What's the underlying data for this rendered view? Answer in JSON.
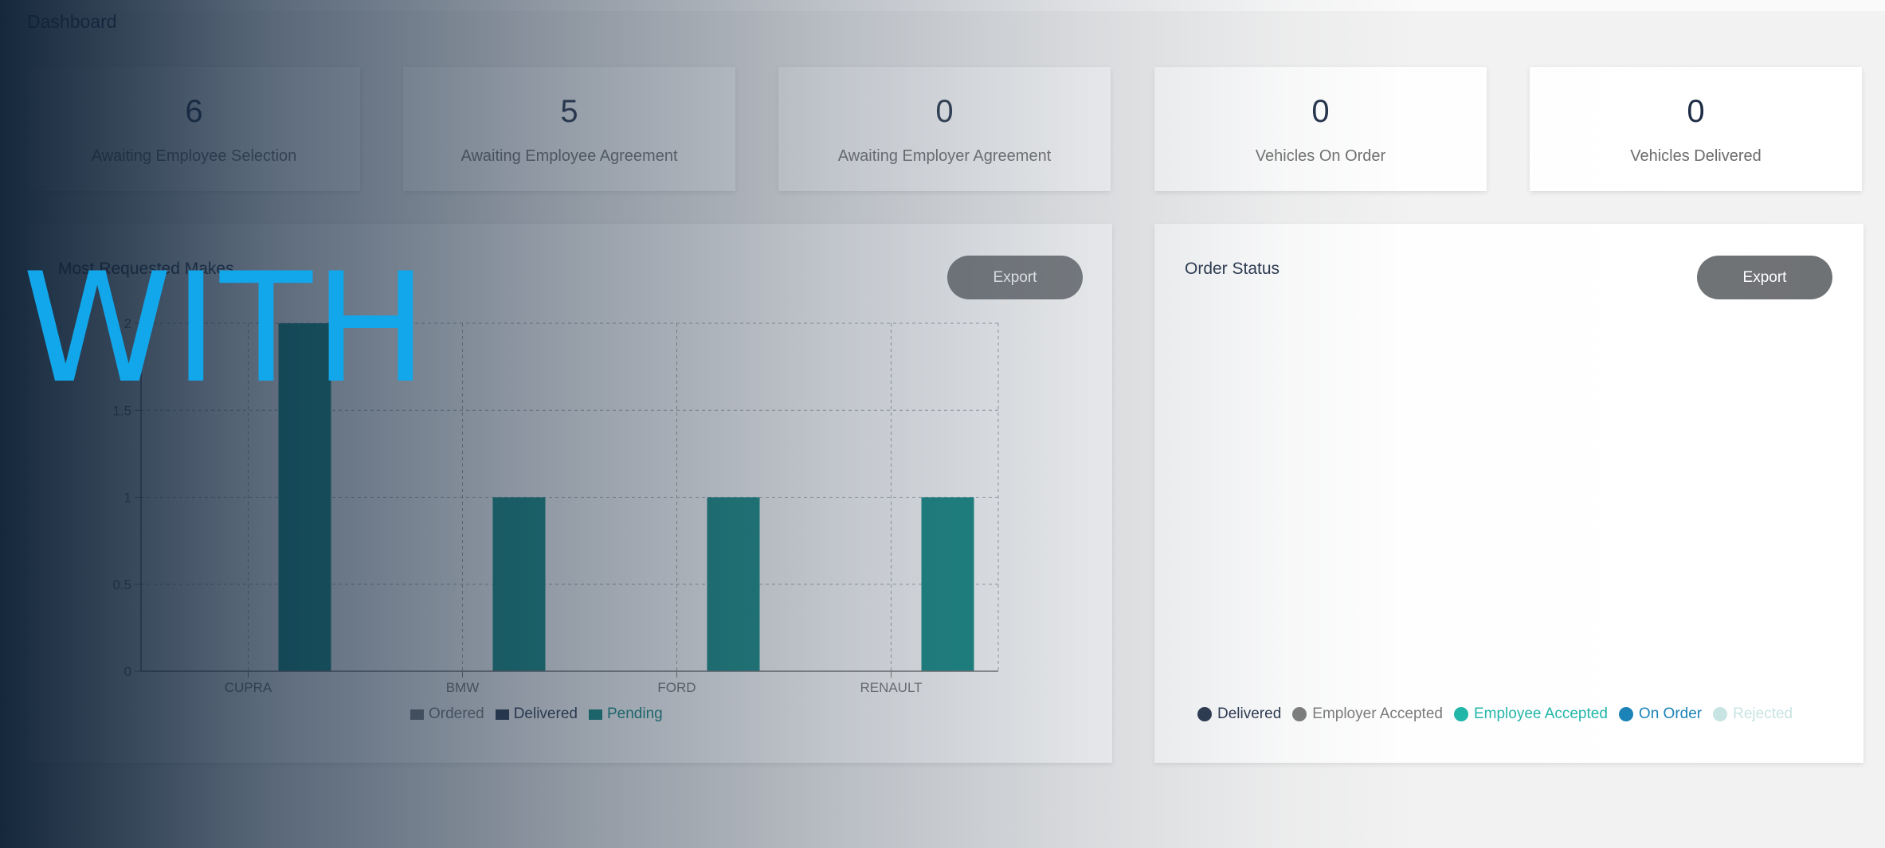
{
  "page": {
    "title": "Dashboard"
  },
  "stats": [
    {
      "value": "6",
      "label": "Awaiting Employee Selection"
    },
    {
      "value": "5",
      "label": "Awaiting Employee Agreement"
    },
    {
      "value": "0",
      "label": "Awaiting Employer Agreement"
    },
    {
      "value": "0",
      "label": "Vehicles On Order"
    },
    {
      "value": "0",
      "label": "Vehicles Delivered"
    }
  ],
  "makes_panel": {
    "title": "Most Requested Makes",
    "export_label": "Export"
  },
  "status_panel": {
    "title": "Order Status",
    "export_label": "Export"
  },
  "status_legend": [
    {
      "label": "Delivered",
      "color": "#1c2b44"
    },
    {
      "label": "Employer Accepted",
      "color": "#777777"
    },
    {
      "label": "Employee Accepted",
      "color": "#1fb5a8"
    },
    {
      "label": "On Order",
      "color": "#1a82b8"
    },
    {
      "label": "Rejected",
      "color": "#c8e4e2"
    }
  ],
  "watermark": "WITH",
  "chart_data": {
    "type": "bar",
    "categories": [
      "CUPRA",
      "BMW",
      "FORD",
      "RENAULT"
    ],
    "series": [
      {
        "name": "Ordered",
        "values": [
          0,
          0,
          0,
          0
        ],
        "color": "#6f7275"
      },
      {
        "name": "Delivered",
        "values": [
          0,
          0,
          0,
          0
        ],
        "color": "#1c2b44"
      },
      {
        "name": "Pending",
        "values": [
          2,
          1,
          1,
          1
        ],
        "color": "#00807a"
      }
    ],
    "yticks": [
      "0",
      "0.5",
      "1",
      "1.5",
      "2"
    ],
    "ylim": [
      0,
      2
    ],
    "grid": true,
    "legend_position": "bottom"
  }
}
